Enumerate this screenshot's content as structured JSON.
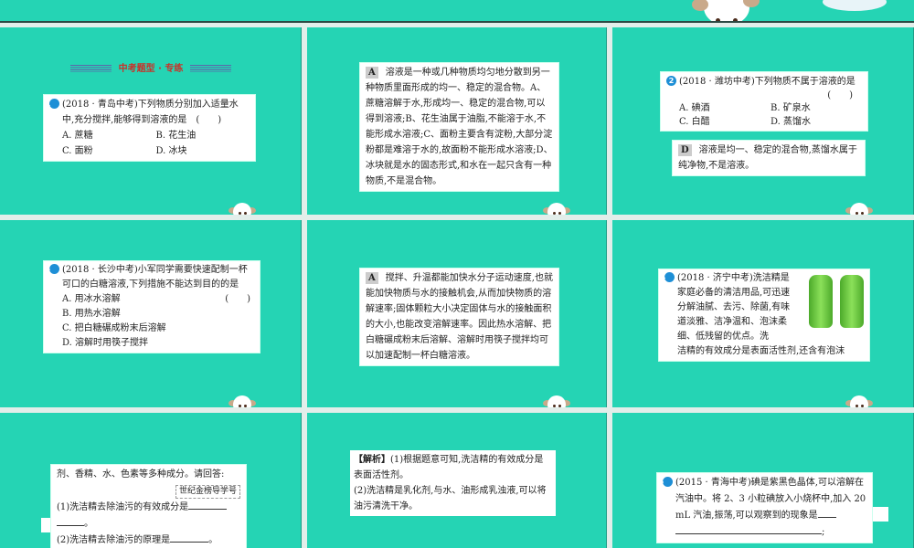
{
  "slide1": {
    "heading": "中考题型 · 专练",
    "q_num": "1",
    "q_text": "(2018 · 青岛中考)下列物质分别加入适量水中,充分搅拌,能够得到溶液的是　(　　)",
    "options": [
      "A. 蔗糖",
      "B. 花生油",
      "C. 面粉",
      "D. 冰块"
    ]
  },
  "slide2": {
    "answer": "A",
    "text": "溶液是一种或几种物质均匀地分散到另一种物质里面形成的均一、稳定的混合物。A、蔗糖溶解于水,形成均一、稳定的混合物,可以得到溶液;B、花生油属于油脂,不能溶于水,不能形成水溶液;C、面粉主要含有淀粉,大部分淀粉都是难溶于水的,故面粉不能形成水溶液;D、冰块就是水的固态形式,和水在一起只含有一种物质,不是混合物。"
  },
  "slide3": {
    "q_num": "2",
    "q_text": "(2018 · 潍坊中考)下列物质不属于溶液的是",
    "paren": "(　　)",
    "options": [
      "A. 碘酒",
      "B. 矿泉水",
      "C. 白醋",
      "D. 蒸馏水"
    ],
    "answer": "D",
    "explanation": "溶液是均一、稳定的混合物,蒸馏水属于纯净物,不是溶液。"
  },
  "slide4": {
    "q_num": "3",
    "q_text": "(2018 · 长沙中考)小军同学需要快速配制一杯可口的白糖溶液,下列措施不能达到目的的是",
    "paren": "(　　)",
    "options": [
      "A. 用冰水溶解",
      "B. 用热水溶解",
      "C. 把白糖碾成粉末后溶解",
      "D. 溶解时用筷子搅拌"
    ]
  },
  "slide5": {
    "answer": "A",
    "text": "搅拌、升温都能加快水分子运动速度,也就能加快物质与水的接触机会,从而加快物质的溶解速率;固体颗粒大小决定固体与水的接触面积的大小,也能改变溶解速率。因此热水溶解、把白糖碾成粉末后溶解、溶解时用筷子搅拌均可以加速配制一杯白糖溶液。"
  },
  "slide6": {
    "q_num": "4",
    "q_text": "(2018 · 济宁中考)洗洁精是家庭必备的清洁用品,可迅速分解油腻、去污、除菌,有味道淡雅、洁净温和、泡沫柔细、低残留的优点。洗",
    "q_text2": "洁精的有效成分是表面活性剂,还含有泡沫"
  },
  "slide7": {
    "intro": "剂、香精、水、色素等多种成分。请回答:",
    "stamp": "世纪金榜导学号",
    "q1": "(1)洗洁精去除油污的有效成分是",
    "q1_end": "。",
    "q2": "(2)洗洁精去除油污的原理是",
    "q2_end": "。"
  },
  "slide8": {
    "label": "【解析】",
    "line1": "(1)根据题意可知,洗洁精的有效成分是表面活性剂。",
    "line2": "(2)洗洁精是乳化剂,与水、油形成乳浊液,可以将油污清洗干净。"
  },
  "slide9": {
    "q_num": "5",
    "q_text": "(2015 · 青海中考)碘是紫黑色晶体,可以溶解在汽油中。将 2、3 小粒碘放入小烧杯中,加入 20 mL 汽油,振荡,可以观察到的现象是",
    "q_end": ";"
  }
}
